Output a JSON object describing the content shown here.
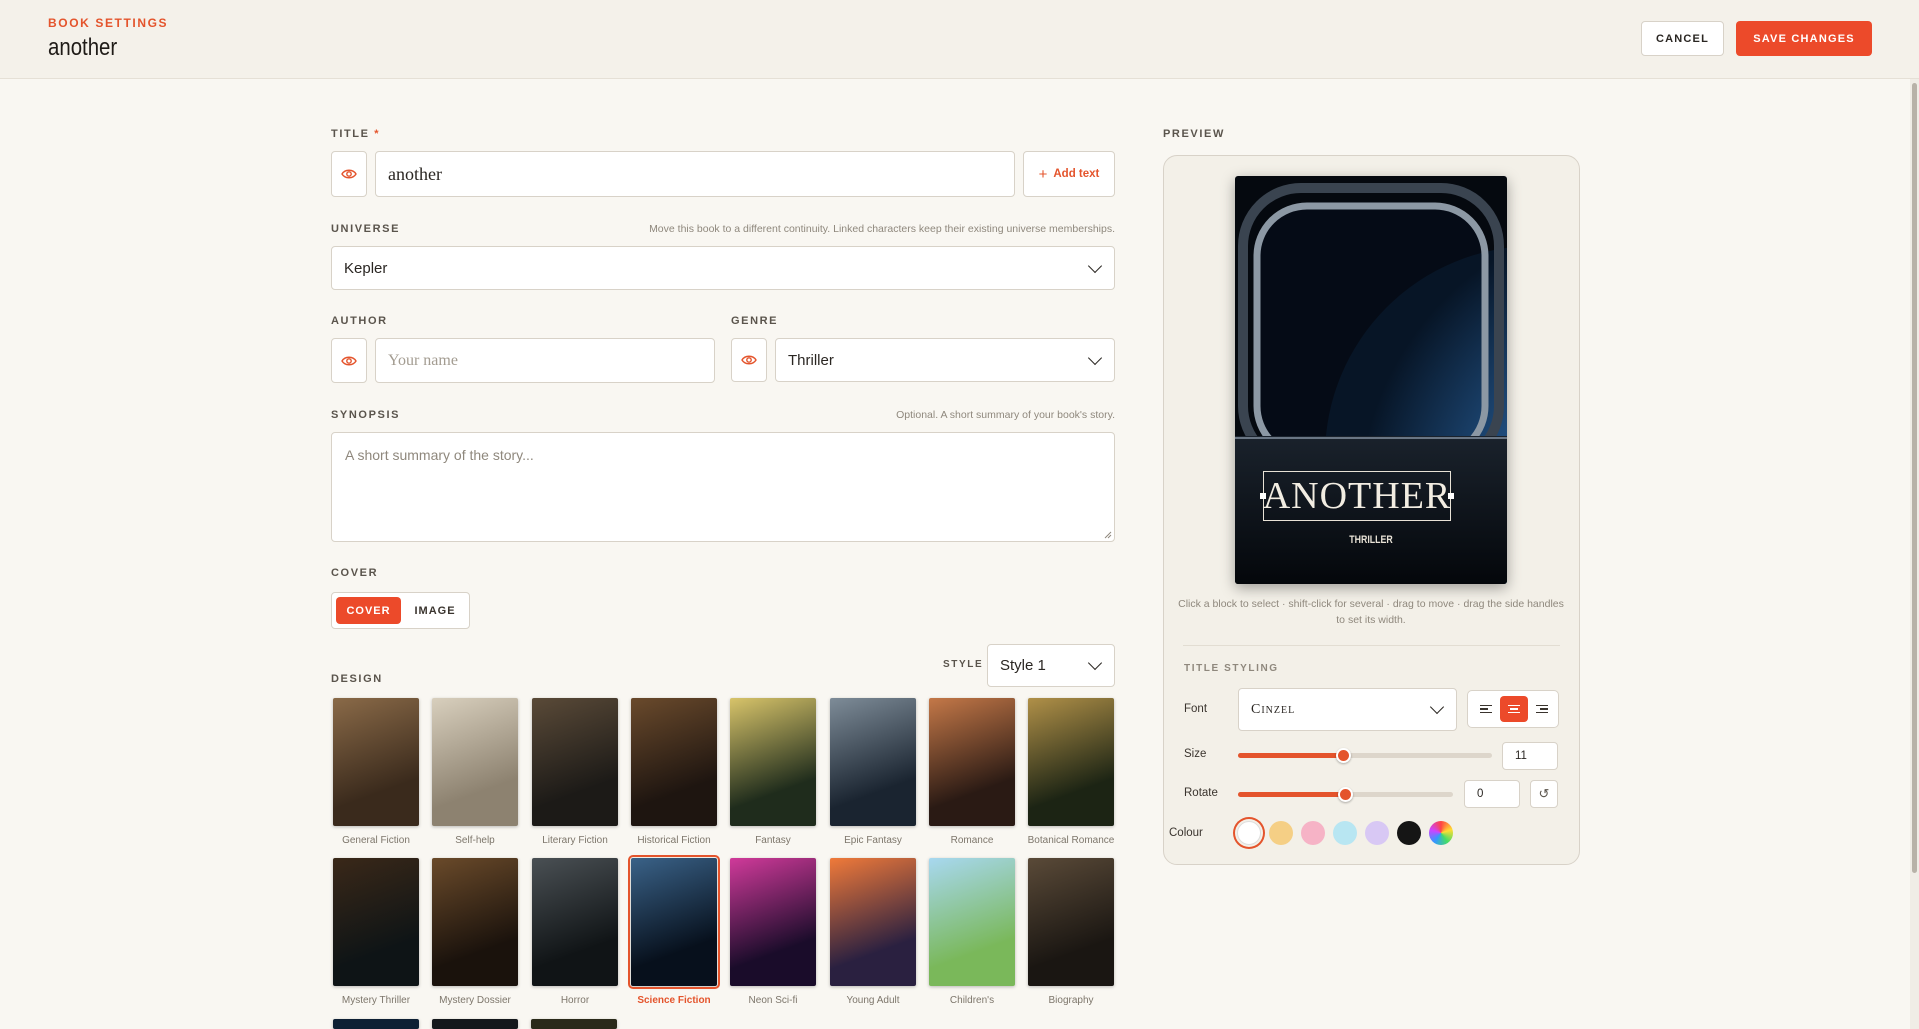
{
  "header": {
    "kicker": "BOOK SETTINGS",
    "title": "another",
    "cancel_label": "CANCEL",
    "save_label": "SAVE CHANGES"
  },
  "form": {
    "title": {
      "label": "TITLE",
      "required_mark": "*",
      "value": "another",
      "add_text_label": "Add text"
    },
    "universe": {
      "label": "UNIVERSE",
      "hint": "Move this book to a different continuity. Linked characters keep their existing universe memberships.",
      "value": "Kepler"
    },
    "author": {
      "label": "AUTHOR",
      "placeholder": "Your name"
    },
    "genre": {
      "label": "GENRE",
      "value": "Thriller"
    },
    "synopsis": {
      "label": "SYNOPSIS",
      "hint": "Optional. A short summary of your book's story.",
      "placeholder": "A short summary of the story..."
    },
    "cover": {
      "label": "COVER",
      "options": [
        "COVER",
        "IMAGE"
      ],
      "selected": "COVER"
    },
    "design": {
      "label": "DESIGN",
      "style_label": "STYLE",
      "style_value": "Style 1",
      "items": [
        {
          "name": "General Fiction",
          "colors": [
            "#3a2a1c",
            "#8a6a48"
          ]
        },
        {
          "name": "Self-help",
          "colors": [
            "#8d8270",
            "#d8cfbd"
          ]
        },
        {
          "name": "Literary Fiction",
          "colors": [
            "#1c1a17",
            "#5a4a38"
          ]
        },
        {
          "name": "Historical Fiction",
          "colors": [
            "#1e1510",
            "#6a4a2c"
          ]
        },
        {
          "name": "Fantasy",
          "colors": [
            "#1f2c1c",
            "#d8c46a"
          ]
        },
        {
          "name": "Epic Fantasy",
          "colors": [
            "#1a2430",
            "#7e8c98"
          ]
        },
        {
          "name": "Romance",
          "colors": [
            "#2a1a14",
            "#c47848"
          ]
        },
        {
          "name": "Botanical Romance",
          "colors": [
            "#1c2414",
            "#b09048"
          ]
        },
        {
          "name": "Mystery Thriller",
          "colors": [
            "#0e1416",
            "#3a2818"
          ]
        },
        {
          "name": "Mystery Dossier",
          "colors": [
            "#1a120c",
            "#6a4a2a"
          ]
        },
        {
          "name": "Horror",
          "colors": [
            "#101416",
            "#4a5054"
          ]
        },
        {
          "name": "Science Fiction",
          "colors": [
            "#07101c",
            "#3a6288"
          ]
        },
        {
          "name": "Neon Sci-fi",
          "colors": [
            "#1a0c2a",
            "#d03a9a"
          ]
        },
        {
          "name": "Young Adult",
          "colors": [
            "#2a2040",
            "#f07a3a"
          ]
        },
        {
          "name": "Children's",
          "colors": [
            "#7ab85a",
            "#a8d8f0"
          ]
        },
        {
          "name": "Biography",
          "colors": [
            "#1a1612",
            "#5a4a38"
          ]
        }
      ],
      "selected": "Science Fiction"
    }
  },
  "preview": {
    "label": "PREVIEW",
    "cover_title": "ANOTHER",
    "cover_genre": "THRILLER",
    "hint": "Click a block to select · shift-click for several · drag to move · drag the side handles to set its width.",
    "styling": {
      "heading": "TITLE STYLING",
      "font_label": "Font",
      "font_value": "Cinzel",
      "size_label": "Size",
      "size_value": "11",
      "rotate_label": "Rotate",
      "rotate_value": "0",
      "colour_label": "Colour",
      "alignment": "center",
      "swatches": [
        "#ffffff",
        "#f5cf85",
        "#f6b3c6",
        "#b8e6f2",
        "#d8c8f4",
        "#151515",
        "rainbow"
      ],
      "selected_swatch": "#ffffff"
    }
  },
  "colors": {
    "accent": "#ec4a2a",
    "background": "#f9f7f2"
  }
}
